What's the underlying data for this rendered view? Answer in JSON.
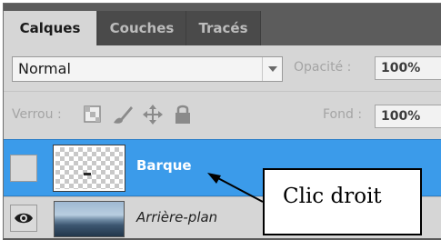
{
  "tabs": [
    {
      "label": "Calques",
      "active": true
    },
    {
      "label": "Couches",
      "active": false
    },
    {
      "label": "Tracés",
      "active": false
    }
  ],
  "blend": {
    "mode": "Normal",
    "opacity_label": "Opacité :",
    "opacity_value": "100%"
  },
  "lock": {
    "label": "Verrou :",
    "icons": [
      "transparency-lock-icon",
      "brush-lock-icon",
      "move-lock-icon",
      "padlock-icon"
    ],
    "fill_label": "Fond :",
    "fill_value": "100%"
  },
  "layers": [
    {
      "name": "Barque",
      "selected": true,
      "visible": false
    },
    {
      "name": "Arrière-plan",
      "selected": false,
      "visible": true
    }
  ],
  "annotation": {
    "text": "Clic droit"
  },
  "colors": {
    "selected_layer": "#3b9bea",
    "panel_bg": "#d6d6d6",
    "tab_bar": "#5c5c5c"
  }
}
